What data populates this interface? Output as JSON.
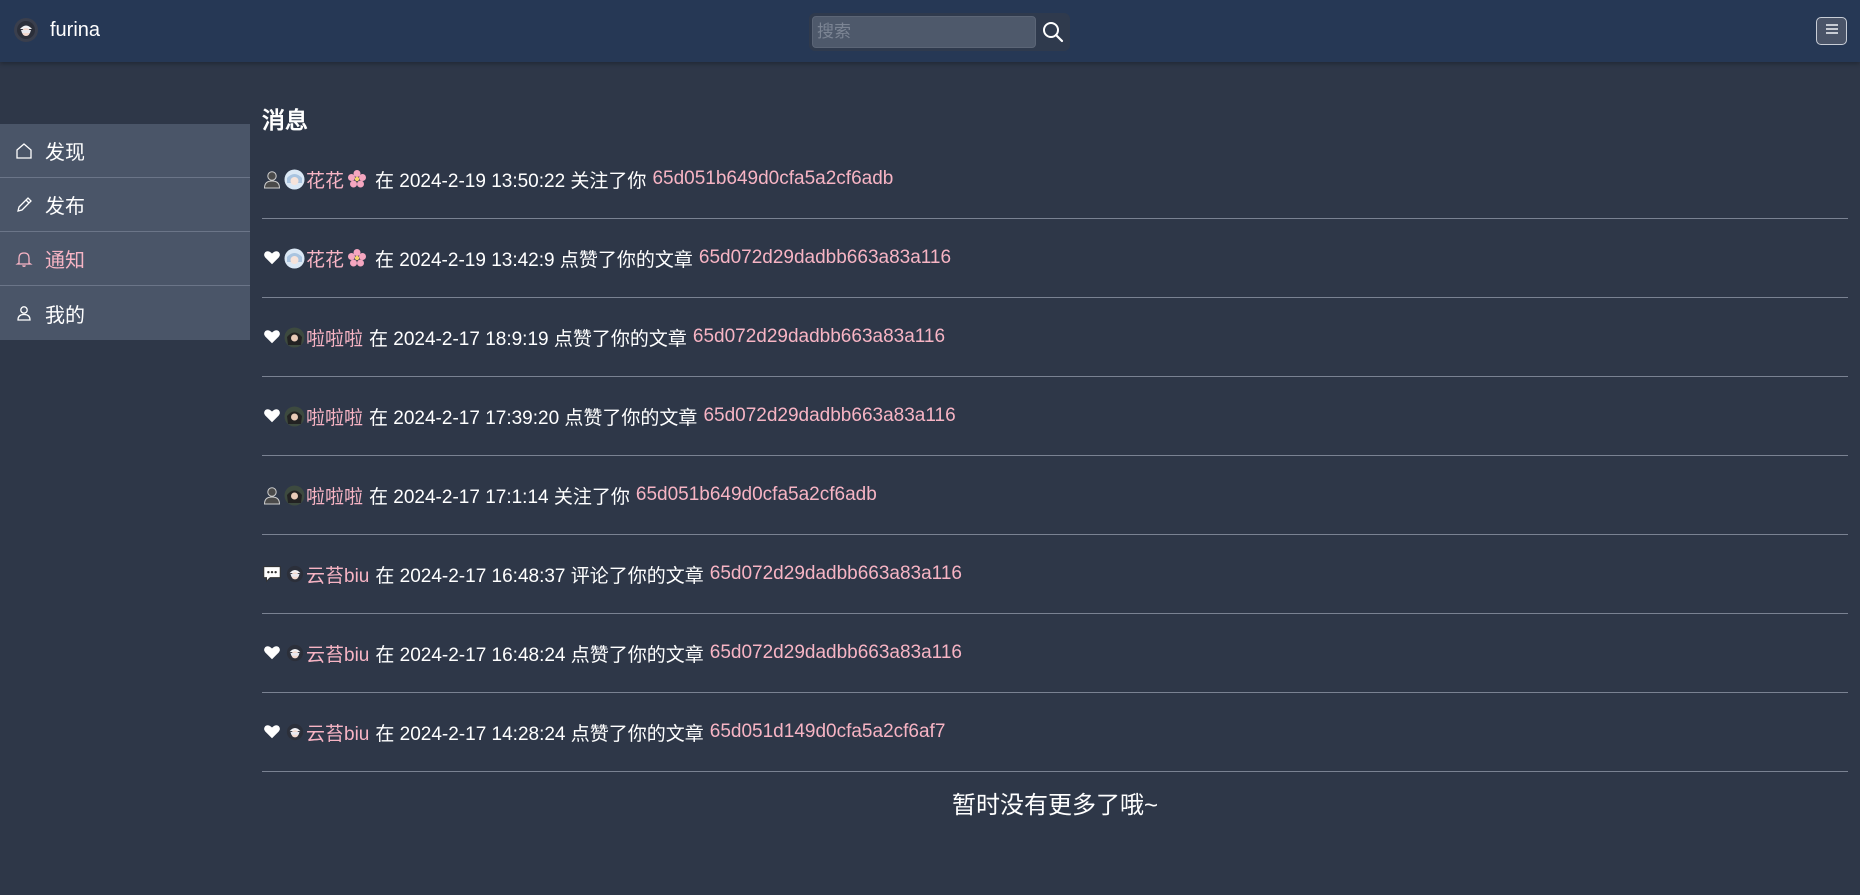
{
  "header": {
    "brand": "furina",
    "search_placeholder": "搜索"
  },
  "sidebar": {
    "items": [
      {
        "label": "发现",
        "icon": "home-icon",
        "active": false
      },
      {
        "label": "发布",
        "icon": "pencil-icon",
        "active": false
      },
      {
        "label": "通知",
        "icon": "bell-icon",
        "active": true
      },
      {
        "label": "我的",
        "icon": "user-icon",
        "active": false
      }
    ]
  },
  "main": {
    "title": "消息",
    "messages": [
      {
        "type": "follow",
        "type_icon": "person-silhouette-icon",
        "avatar": "anime-avatar-light",
        "user": "花花",
        "flower": true,
        "text": "在 2024-2-19 13:50:22 关注了你",
        "link": "65d051b649d0cfa5a2cf6adb"
      },
      {
        "type": "like",
        "type_icon": "white-heart-icon",
        "avatar": "anime-avatar-light",
        "user": "花花",
        "flower": true,
        "text": "在 2024-2-19 13:42:9 点赞了你的文章",
        "link": "65d072d29dadbb663a83a116"
      },
      {
        "type": "like",
        "type_icon": "white-heart-icon",
        "avatar": "anime-avatar-dark",
        "user": "啦啦啦",
        "flower": false,
        "text": "在 2024-2-17 18:9:19 点赞了你的文章",
        "link": "65d072d29dadbb663a83a116"
      },
      {
        "type": "like",
        "type_icon": "white-heart-icon",
        "avatar": "anime-avatar-dark",
        "user": "啦啦啦",
        "flower": false,
        "text": "在 2024-2-17 17:39:20 点赞了你的文章",
        "link": "65d072d29dadbb663a83a116"
      },
      {
        "type": "follow",
        "type_icon": "person-silhouette-icon",
        "avatar": "anime-avatar-dark",
        "user": "啦啦啦",
        "flower": false,
        "text": "在 2024-2-17 17:1:14 关注了你",
        "link": "65d051b649d0cfa5a2cf6adb"
      },
      {
        "type": "comment",
        "type_icon": "speech-bubble-icon",
        "avatar": "furina-avatar",
        "user": "云苔biu",
        "flower": false,
        "text": "在 2024-2-17 16:48:37 评论了你的文章",
        "link": "65d072d29dadbb663a83a116"
      },
      {
        "type": "like",
        "type_icon": "white-heart-icon",
        "avatar": "furina-avatar",
        "user": "云苔biu",
        "flower": false,
        "text": "在 2024-2-17 16:48:24 点赞了你的文章",
        "link": "65d072d29dadbb663a83a116"
      },
      {
        "type": "like",
        "type_icon": "white-heart-icon",
        "avatar": "furina-avatar",
        "user": "云苔biu",
        "flower": false,
        "text": "在 2024-2-17 14:28:24 点赞了你的文章",
        "link": "65d051d149d0cfa5a2cf6af7"
      }
    ],
    "end_note": "暂时没有更多了哦~"
  },
  "colors": {
    "background": "#2e3748",
    "header": "#263855",
    "sidebar_item": "#4a5568",
    "accent_pink": "#f7b4c4",
    "divider": "#7a8292"
  }
}
